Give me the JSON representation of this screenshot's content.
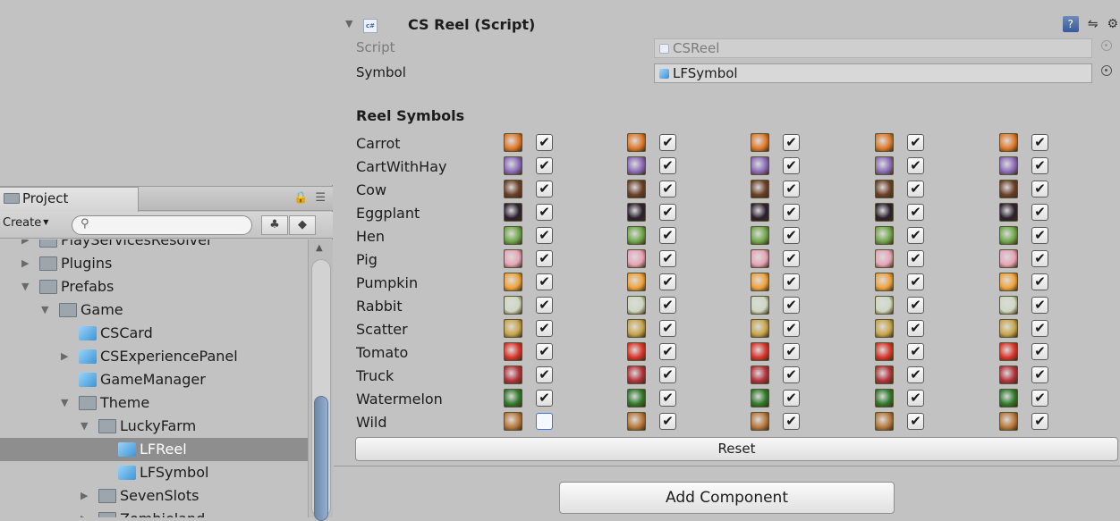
{
  "project_panel": {
    "tab_label": "Project",
    "create_label": "Create",
    "search_placeholder": "",
    "tree": [
      {
        "label": "PlayServicesResolver",
        "depth": 1,
        "type": "folder",
        "arrow": "collapsed",
        "selected": false
      },
      {
        "label": "Plugins",
        "depth": 1,
        "type": "folder",
        "arrow": "collapsed",
        "selected": false
      },
      {
        "label": "Prefabs",
        "depth": 1,
        "type": "folder",
        "arrow": "expanded",
        "selected": false
      },
      {
        "label": "Game",
        "depth": 2,
        "type": "folder",
        "arrow": "expanded",
        "selected": false
      },
      {
        "label": "CSCard",
        "depth": 3,
        "type": "prefab",
        "arrow": "",
        "selected": false
      },
      {
        "label": "CSExperiencePanel",
        "depth": 3,
        "type": "prefab",
        "arrow": "collapsed",
        "selected": false
      },
      {
        "label": "GameManager",
        "depth": 3,
        "type": "prefab",
        "arrow": "",
        "selected": false
      },
      {
        "label": "Theme",
        "depth": 3,
        "type": "folder",
        "arrow": "expanded",
        "selected": false
      },
      {
        "label": "LuckyFarm",
        "depth": 4,
        "type": "folder",
        "arrow": "expanded",
        "selected": false
      },
      {
        "label": "LFReel",
        "depth": 5,
        "type": "prefab",
        "arrow": "",
        "selected": true
      },
      {
        "label": "LFSymbol",
        "depth": 5,
        "type": "prefab",
        "arrow": "",
        "selected": false
      },
      {
        "label": "SevenSlots",
        "depth": 4,
        "type": "folder",
        "arrow": "collapsed",
        "selected": false
      },
      {
        "label": "Zombieland",
        "depth": 4,
        "type": "folder",
        "arrow": "collapsed",
        "selected": false
      }
    ]
  },
  "inspector": {
    "component_title": "CS Reel (Script)",
    "cs_badge": "c#",
    "script_label": "Script",
    "script_value": "CSReel",
    "symbol_label": "Symbol",
    "symbol_value": "LFSymbol",
    "reel_symbols_heading": "Reel Symbols",
    "reel_count": 5,
    "symbols": [
      {
        "name": "Carrot",
        "color": "#e07a28",
        "checks": [
          true,
          true,
          true,
          true,
          true
        ]
      },
      {
        "name": "CartWithHay",
        "color": "#8a6bb8",
        "checks": [
          true,
          true,
          true,
          true,
          true
        ]
      },
      {
        "name": "Cow",
        "color": "#6b3f26",
        "checks": [
          true,
          true,
          true,
          true,
          true
        ]
      },
      {
        "name": "Eggplant",
        "color": "#2a1f2e",
        "checks": [
          true,
          true,
          true,
          true,
          true
        ]
      },
      {
        "name": "Hen",
        "color": "#6fa84a",
        "checks": [
          true,
          true,
          true,
          true,
          true
        ]
      },
      {
        "name": "Pig",
        "color": "#e8a3b8",
        "checks": [
          true,
          true,
          true,
          true,
          true
        ]
      },
      {
        "name": "Pumpkin",
        "color": "#f0a23a",
        "checks": [
          true,
          true,
          true,
          true,
          true
        ]
      },
      {
        "name": "Rabbit",
        "color": "#cfd8c0",
        "checks": [
          true,
          true,
          true,
          true,
          true
        ]
      },
      {
        "name": "Scatter",
        "color": "#c9a54a",
        "checks": [
          true,
          true,
          true,
          true,
          true
        ]
      },
      {
        "name": "Tomato",
        "color": "#d9342a",
        "checks": [
          true,
          true,
          true,
          true,
          true
        ]
      },
      {
        "name": "Truck",
        "color": "#b3323a",
        "checks": [
          true,
          true,
          true,
          true,
          true
        ]
      },
      {
        "name": "Watermelon",
        "color": "#2f7a2a",
        "checks": [
          true,
          true,
          true,
          true,
          true
        ]
      },
      {
        "name": "Wild",
        "color": "#b8783a",
        "checks": [
          false,
          true,
          true,
          true,
          true
        ]
      }
    ],
    "reset_label": "Reset",
    "add_component_label": "Add Component"
  },
  "icons": {
    "help": "help-icon",
    "layout": "layout-icon",
    "gear": "gear-icon",
    "lock": "lock-icon"
  }
}
